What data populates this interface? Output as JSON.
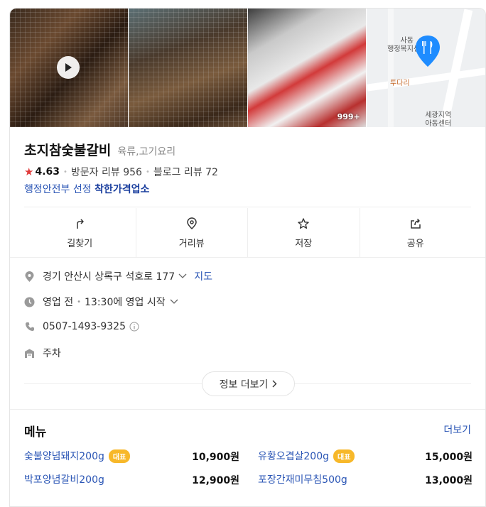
{
  "photos": {
    "more_count": "999+"
  },
  "map": {
    "label1": "사동\n행정복지센터",
    "label2": "투다리",
    "label3": "세광지역\n아동센터"
  },
  "place": {
    "name": "초지참숯불갈비",
    "category": "육류,고기요리",
    "rating": "4.63",
    "visitor_reviews": "방문자 리뷰 956",
    "blog_reviews": "블로그 리뷰 72",
    "badge_prefix": "행정안전부 선정",
    "badge_name": "착한가격업소"
  },
  "actions": [
    {
      "label": "길찾기",
      "icon": "directions-icon"
    },
    {
      "label": "거리뷰",
      "icon": "location-pin-icon"
    },
    {
      "label": "저장",
      "icon": "star-icon"
    },
    {
      "label": "공유",
      "icon": "share-icon"
    }
  ],
  "info": {
    "address": "경기 안산시 상록구 석호로 177",
    "map_link": "지도",
    "status": "영업 전",
    "hours": "13:30에 영업 시작",
    "phone": "0507-1493-9325",
    "parking": "주차"
  },
  "more_info_label": "정보 더보기",
  "menu": {
    "title": "메뉴",
    "more": "더보기",
    "items": [
      {
        "name": "숯불양념돼지200g",
        "tag": "대표",
        "price": "10,900원"
      },
      {
        "name": "유황오겹살200g",
        "tag": "대표",
        "price": "15,000원"
      },
      {
        "name": "박포양념갈비200g",
        "tag": "",
        "price": "12,900원"
      },
      {
        "name": "포장간재미무침500g",
        "tag": "",
        "price": "13,000원"
      }
    ]
  },
  "colors": {
    "link": "#2a55b5",
    "star": "#e03b3b",
    "tag": "#f7b82a",
    "map_pin": "#1e8cff"
  }
}
